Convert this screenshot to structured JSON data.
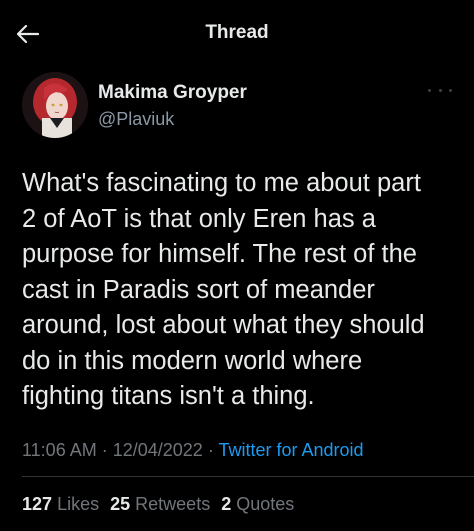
{
  "header": {
    "title": "Thread",
    "back_icon": "arrow-left-icon"
  },
  "author": {
    "display_name": "Makima Groyper",
    "handle": "@Plaviuk",
    "more_icon": "more-horizontal-icon"
  },
  "tweet": {
    "lines": [
      "What's fascinating to me about part",
      "2 of AoT is that only Eren has a",
      "purpose for himself. The rest of the",
      "cast in Paradis sort of meander",
      "around, lost about what they should",
      "do in this modern world where",
      "fighting titans isn't a thing."
    ]
  },
  "meta": {
    "time": "11:06 AM",
    "separator1": " · ",
    "date": "12/04/2022",
    "separator2": " · ",
    "source": "Twitter for Android"
  },
  "stats": {
    "likes_count": "127",
    "likes_label": "Likes",
    "retweets_count": "25",
    "retweets_label": "Retweets",
    "quotes_count": "2",
    "quotes_label": "Quotes"
  },
  "colors": {
    "background": "#000000",
    "text_primary": "#E7E9EA",
    "text_secondary": "#71767B",
    "link": "#1D9BF0",
    "divider": "#2F3336"
  }
}
